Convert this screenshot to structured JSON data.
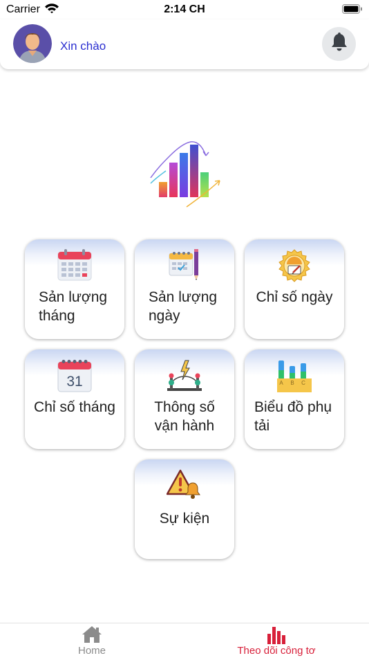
{
  "status_bar": {
    "carrier": "Carrier",
    "time": "2:14 CH"
  },
  "header": {
    "greeting": "Xin chào"
  },
  "tiles": [
    {
      "label": "Sản lượng tháng",
      "icon": "calendar-icon"
    },
    {
      "label": "Sản lượng ngày",
      "icon": "calendar-pencil-icon"
    },
    {
      "label": "Chỉ số ngày",
      "icon": "gauge-badge-icon"
    },
    {
      "label": "Chỉ số tháng",
      "icon": "calendar-31-icon",
      "icon_text": "31"
    },
    {
      "label": "Thông số vận hành",
      "icon": "power-line-icon"
    },
    {
      "label": "Biểu đồ phụ tải",
      "icon": "abc-bar-chart-icon",
      "icon_text": [
        "A",
        "B",
        "C"
      ]
    },
    {
      "label": "Sự kiện",
      "icon": "warning-bell-icon"
    }
  ],
  "tab_bar": {
    "items": [
      {
        "label": "Home",
        "icon": "home-icon",
        "active": false
      },
      {
        "label": "Theo dõi công tơ",
        "icon": "bar-chart-icon",
        "active": true
      }
    ]
  },
  "colors": {
    "accent": "#d8203a",
    "greeting": "#2a2ed0",
    "inactive": "#8b8b8b"
  }
}
